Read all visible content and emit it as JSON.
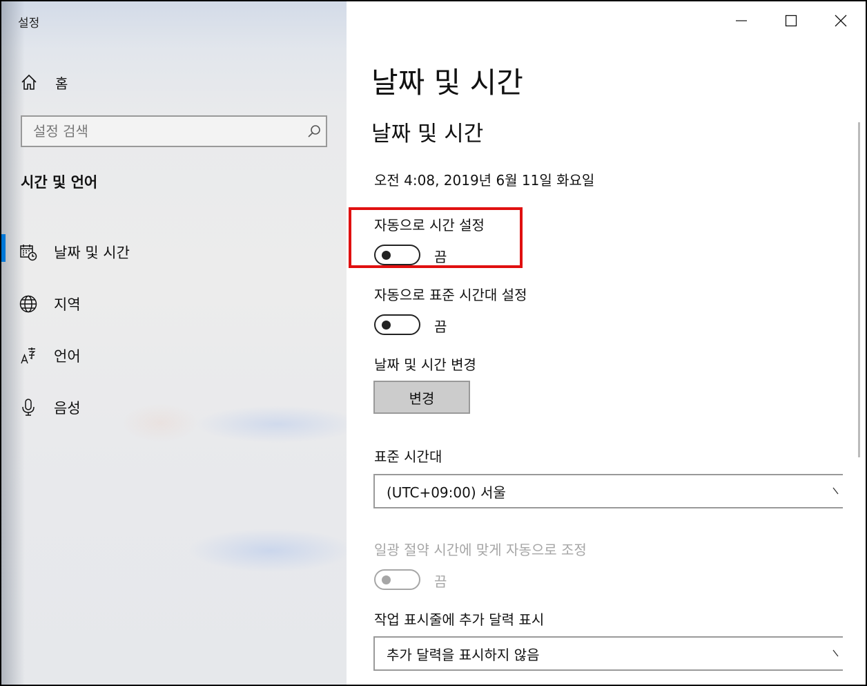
{
  "window": {
    "title": "설정"
  },
  "sidebar": {
    "home_label": "홈",
    "search_placeholder": "설정 검색",
    "section_title": "시간 및 언어",
    "items": [
      {
        "label": "날짜 및 시간",
        "icon": "calendar-clock-icon",
        "selected": true
      },
      {
        "label": "지역",
        "icon": "globe-icon",
        "selected": false
      },
      {
        "label": "언어",
        "icon": "language-icon",
        "selected": false
      },
      {
        "label": "음성",
        "icon": "microphone-icon",
        "selected": false
      }
    ]
  },
  "content": {
    "page_title": "날짜 및 시간",
    "section_title": "날짜 및 시간",
    "current_datetime": "오전 4:08, 2019년 6월 11일 화요일",
    "auto_time": {
      "label": "자동으로 시간 설정",
      "state": "끔",
      "on": false
    },
    "auto_timezone": {
      "label": "자동으로 표준 시간대 설정",
      "state": "끔",
      "on": false
    },
    "change_datetime": {
      "label": "날짜 및 시간 변경",
      "button": "변경"
    },
    "timezone": {
      "label": "표준 시간대",
      "value": "(UTC+09:00) 서울"
    },
    "dst": {
      "label": "일광 절약 시간에 맞게 자동으로 조정",
      "state": "끔",
      "on": false,
      "enabled": false
    },
    "taskbar_calendar": {
      "label": "작업 표시줄에 추가 달력 표시",
      "value": "추가 달력을 표시하지 않음"
    }
  },
  "colors": {
    "accent": "#0078d7",
    "highlight_box": "#e01010"
  }
}
